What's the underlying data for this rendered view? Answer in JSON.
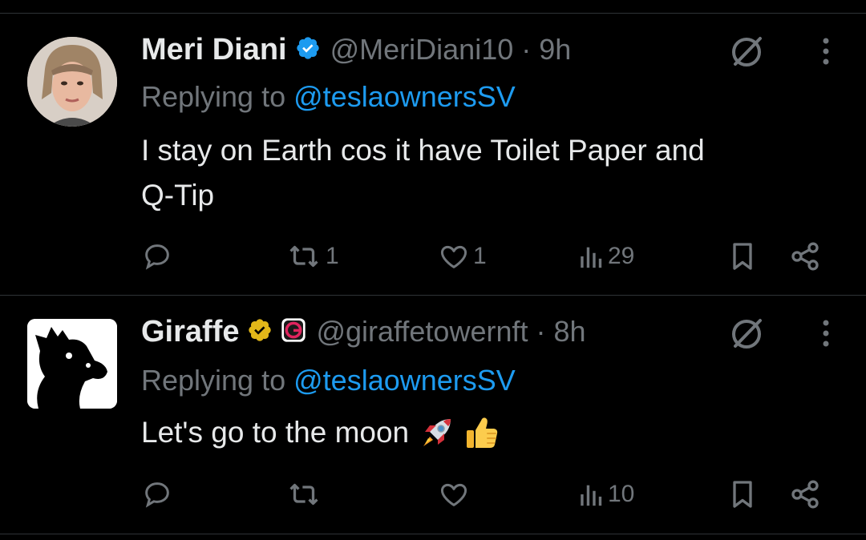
{
  "tweets": [
    {
      "name": "Meri Diani",
      "handle": "@MeriDiani10",
      "dot": "·",
      "time": "9h",
      "reply_prefix": "Replying to",
      "reply_to": "@teslaownersSV",
      "text_lines": [
        "I stay on Earth cos it have Toilet Paper and",
        "Q-Tip"
      ],
      "verified_badge": "blue",
      "counts": {
        "reply": "",
        "retweet": "1",
        "like": "1",
        "views": "29"
      }
    },
    {
      "name": "Giraffe",
      "handle": "@giraffetowernft",
      "dot": "·",
      "time": "8h",
      "reply_prefix": "Replying to",
      "reply_to": "@teslaownersSV",
      "text": "Let's go to the moon",
      "emojis": [
        "rocket",
        "thumbs-up"
      ],
      "verified_badge": "gold",
      "counts": {
        "reply": "",
        "retweet": "",
        "like": "",
        "views": "10"
      }
    }
  ],
  "colors": {
    "background": "#000000",
    "text": "#e7e9ea",
    "muted": "#71767b",
    "link": "#1d9bf0",
    "blue_badge": "#1d9bf0",
    "gold_badge": "#e2b719"
  },
  "icons": [
    "grok-icon",
    "more-icon",
    "reply-icon",
    "retweet-icon",
    "like-icon",
    "views-icon",
    "bookmark-icon",
    "share-icon"
  ]
}
